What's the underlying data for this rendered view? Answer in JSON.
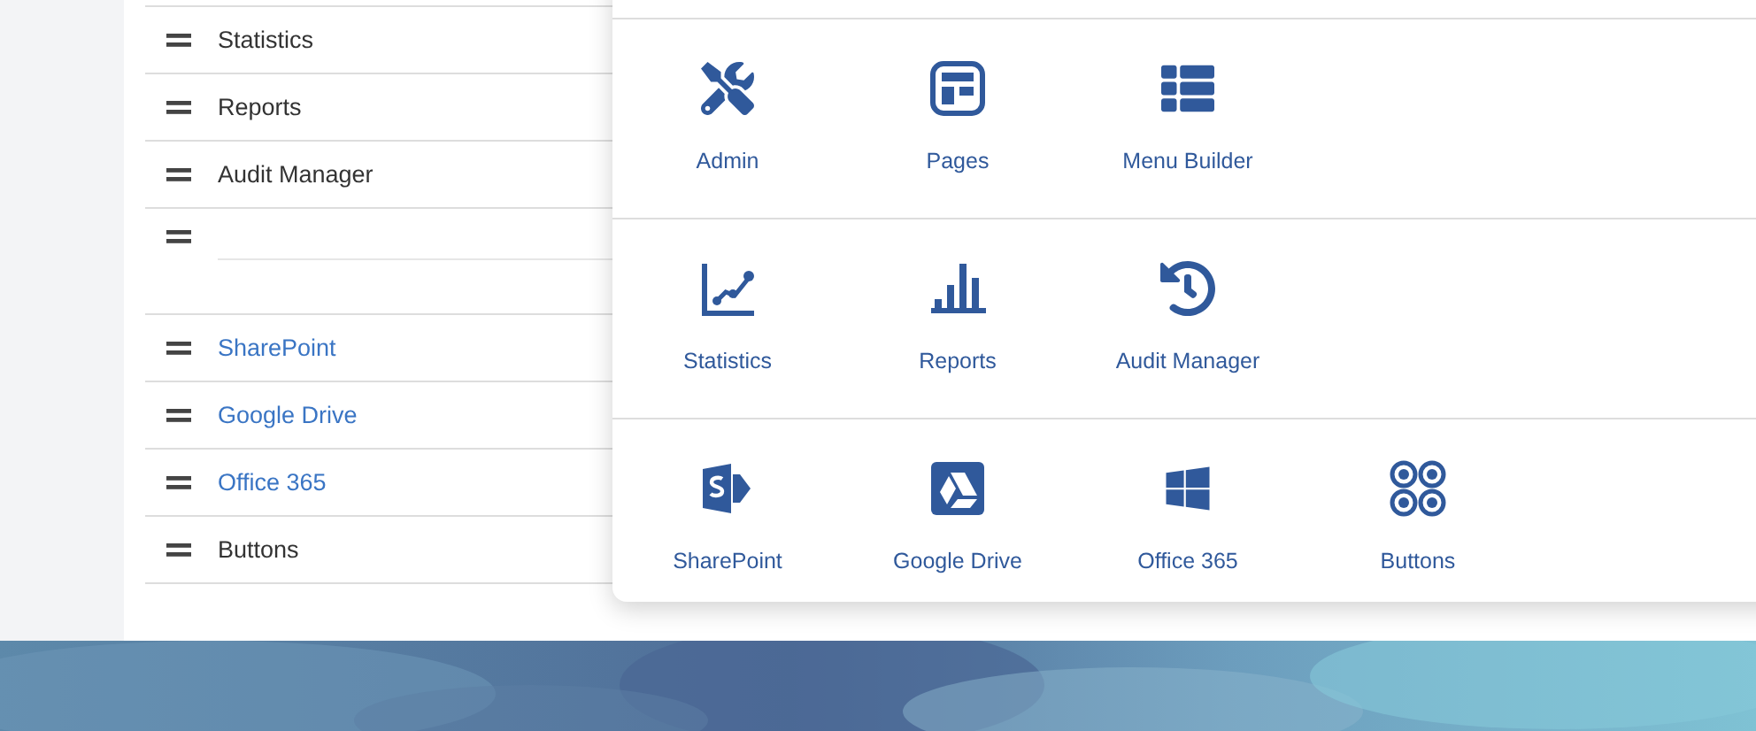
{
  "menu_list": [
    {
      "kind": "text",
      "label": "Statistics"
    },
    {
      "kind": "text",
      "label": "Reports"
    },
    {
      "kind": "text",
      "label": "Audit Manager"
    },
    {
      "kind": "field"
    },
    {
      "kind": "link",
      "label": "SharePoint"
    },
    {
      "kind": "link",
      "label": "Google Drive"
    },
    {
      "kind": "link",
      "label": "Office 365"
    },
    {
      "kind": "text",
      "label": "Buttons"
    }
  ],
  "app_grid": [
    [
      {
        "label": "Admin"
      },
      {
        "label": "Pages"
      },
      {
        "label": "Menu Builder"
      }
    ],
    [
      {
        "label": "Statistics"
      },
      {
        "label": "Reports"
      },
      {
        "label": "Audit Manager"
      }
    ],
    [
      {
        "label": "SharePoint"
      },
      {
        "label": "Google Drive"
      },
      {
        "label": "Office 365"
      },
      {
        "label": "Buttons"
      }
    ]
  ],
  "backdrop": {
    "kind": "picture"
  }
}
